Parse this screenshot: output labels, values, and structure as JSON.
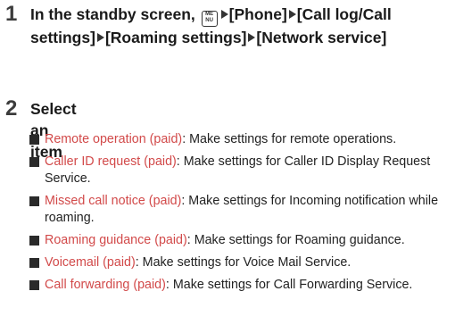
{
  "step1": {
    "number": "1",
    "prefix": "In the standby screen, ",
    "menu_key_label": [
      "ME",
      "NU"
    ],
    "path": [
      "[Phone]",
      "[Call log/​Call settings]",
      "[Roaming settings]",
      "[Network service]"
    ]
  },
  "step2": {
    "number": "2",
    "text": "Select an item"
  },
  "items": [
    {
      "term": "Remote operation (paid)",
      "desc": ": Make settings for remote operations."
    },
    {
      "term": "Caller ID request (paid)",
      "desc": ": Make settings for Caller ID Display Request Service."
    },
    {
      "term": "Missed call notice (paid)",
      "desc": ": Make settings for Incoming notification while roaming."
    },
    {
      "term": "Roaming guidance (paid)",
      "desc": ": Make settings for Roaming guidance."
    },
    {
      "term": "Voicemail (paid)",
      "desc": ": Make settings for Voice Mail Service."
    },
    {
      "term": "Call forwarding (paid)",
      "desc": ": Make settings for Call Forwarding Service."
    }
  ],
  "colors": {
    "term": "#d24a4a",
    "text": "#222222"
  },
  "icons": [
    "menu-key-icon",
    "triangle-arrow-icon",
    "square-bullet-icon"
  ]
}
